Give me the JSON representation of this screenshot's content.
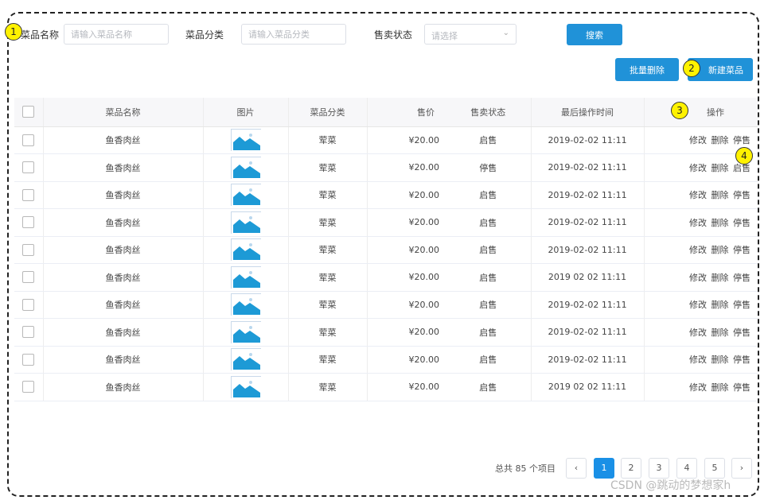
{
  "filters": {
    "dish_name_label": "菜品名称",
    "dish_name_placeholder": "请输入菜品名称",
    "category_label": "菜品分类",
    "category_placeholder": "请输入菜品分类",
    "status_label": "售卖状态",
    "status_placeholder": "请选择",
    "search_button": "搜索"
  },
  "toolbar": {
    "batch_delete": "批量删除",
    "new_dish": "新建菜品"
  },
  "markers": [
    "1",
    "2",
    "3",
    "4"
  ],
  "table": {
    "headers": [
      "菜品名称",
      "图片",
      "菜品分类",
      "售价",
      "售卖状态",
      "最后操作时间",
      "操作"
    ],
    "rows": [
      {
        "name": "鱼香肉丝",
        "category": "荤菜",
        "price": "¥20.00",
        "status": "启售",
        "time": "2019-02-02 11:11",
        "op1": "修改",
        "op2": "删除",
        "op3": "停售"
      },
      {
        "name": "鱼香肉丝",
        "category": "荤菜",
        "price": "¥20.00",
        "status": "停售",
        "time": "2019-02-02 11:11",
        "op1": "修改",
        "op2": "删除",
        "op3": "启售"
      },
      {
        "name": "鱼香肉丝",
        "category": "荤菜",
        "price": "¥20.00",
        "status": "启售",
        "time": "2019-02-02 11:11",
        "op1": "修改",
        "op2": "删除",
        "op3": "停售"
      },
      {
        "name": "鱼香肉丝",
        "category": "荤菜",
        "price": "¥20.00",
        "status": "启售",
        "time": "2019-02-02 11:11",
        "op1": "修改",
        "op2": "删除",
        "op3": "停售"
      },
      {
        "name": "鱼香肉丝",
        "category": "荤菜",
        "price": "¥20.00",
        "status": "启售",
        "time": "2019-02-02 11:11",
        "op1": "修改",
        "op2": "删除",
        "op3": "停售"
      },
      {
        "name": "鱼香肉丝",
        "category": "荤菜",
        "price": "¥20.00",
        "status": "启售",
        "time": "2019 02 02 11:11",
        "op1": "修改",
        "op2": "删除",
        "op3": "停售"
      },
      {
        "name": "鱼香肉丝",
        "category": "荤菜",
        "price": "¥20.00",
        "status": "启售",
        "time": "2019-02-02 11:11",
        "op1": "修改",
        "op2": "删除",
        "op3": "停售"
      },
      {
        "name": "鱼香肉丝",
        "category": "荤菜",
        "price": "¥20.00",
        "status": "启售",
        "time": "2019-02-02 11:11",
        "op1": "修改",
        "op2": "删除",
        "op3": "停售"
      },
      {
        "name": "鱼香肉丝",
        "category": "荤菜",
        "price": "¥20.00",
        "status": "启售",
        "time": "2019-02-02 11:11",
        "op1": "修改",
        "op2": "删除",
        "op3": "停售"
      },
      {
        "name": "鱼香肉丝",
        "category": "荤菜",
        "price": "¥20.00",
        "status": "启售",
        "time": "2019 02 02 11:11",
        "op1": "修改",
        "op2": "删除",
        "op3": "停售"
      }
    ]
  },
  "pagination": {
    "total_text": "总共 85 个项目",
    "prev": "‹",
    "next": "›",
    "pages": [
      "1",
      "2",
      "3",
      "4",
      "5"
    ],
    "current": "1"
  },
  "watermark": "CSDN @跳动的梦想家h",
  "colors": {
    "primary": "#2092d8",
    "image_icon": "#1d9ad6"
  }
}
